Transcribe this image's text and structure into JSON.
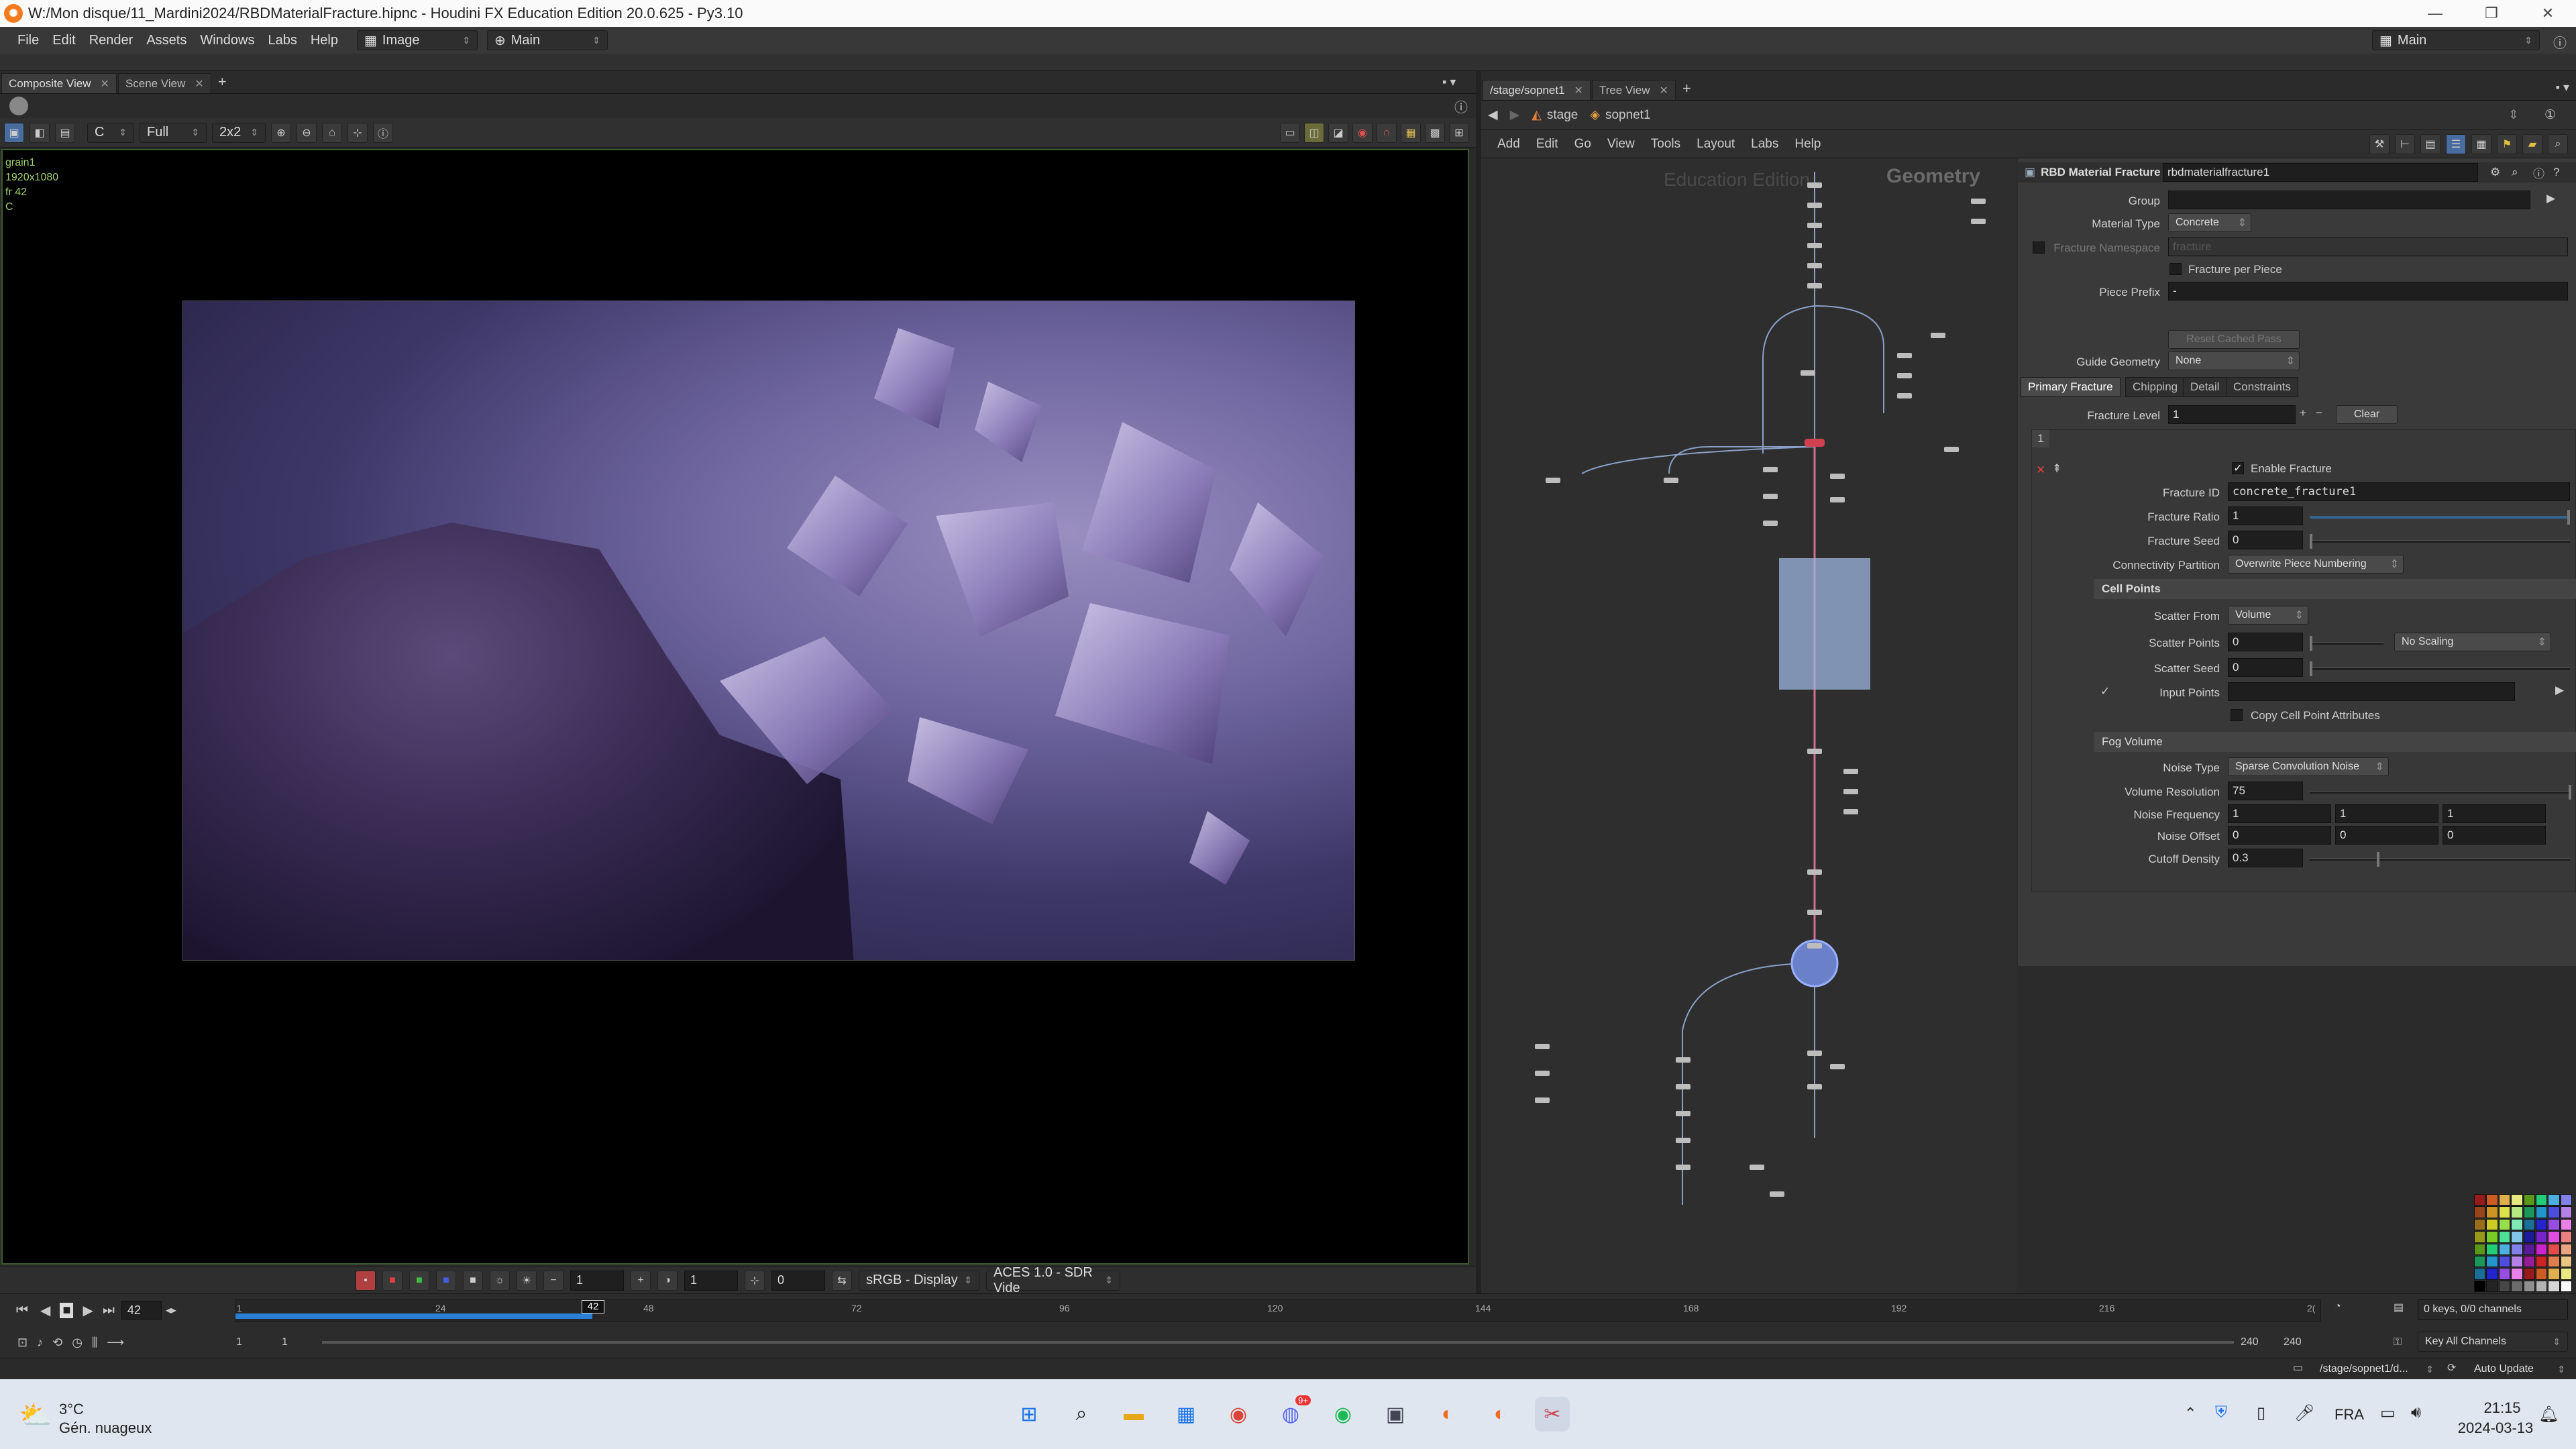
{
  "window": {
    "title": "W:/Mon disque/11_Mardini2024/RBDMaterialFracture.hipnc - Houdini FX Education Edition 20.0.625 - Py3.10"
  },
  "menubar": {
    "items": [
      "File",
      "Edit",
      "Render",
      "Assets",
      "Windows",
      "Labs",
      "Help"
    ],
    "desktop": "Image",
    "runtime": "Main",
    "desktop_right": "Main"
  },
  "left_tabs": [
    {
      "label": "Composite View"
    },
    {
      "label": "Scene View"
    }
  ],
  "viewer": {
    "channel": "C",
    "resolution": "Full",
    "tile": "2x2",
    "info": {
      "name": "grain1",
      "size": "1920x1080",
      "frame": "fr 42",
      "channel": "C"
    },
    "bottom": {
      "frame_a": "1",
      "frame_b": "1",
      "frame_c": "0",
      "display": "sRGB - Display",
      "view": "ACES 1.0 - SDR Vide"
    }
  },
  "right_tabs": [
    {
      "label": "/stage/sopnet1"
    },
    {
      "label": "Tree View"
    }
  ],
  "path": {
    "root": "stage",
    "child": "sopnet1"
  },
  "net_menu": [
    "Add",
    "Edit",
    "Go",
    "View",
    "Tools",
    "Layout",
    "Labs",
    "Help"
  ],
  "network": {
    "edition_label": "Education Edition",
    "context_label": "Geometry"
  },
  "params": {
    "node_type": "RBD Material Fracture",
    "node_name": "rbdmaterialfracture1",
    "group_label": "Group",
    "group_value": "",
    "material_type_label": "Material Type",
    "material_type": "Concrete",
    "fracture_namespace_label": "Fracture Namespace",
    "fracture_namespace": "fracture",
    "fracture_per_piece": "Fracture per Piece",
    "piece_prefix_label": "Piece Prefix",
    "piece_prefix": "-",
    "reset_cached_pass": "Reset Cached Pass",
    "guide_geometry_label": "Guide Geometry",
    "guide_geometry": "None",
    "tabs": [
      "Primary Fracture",
      "Chipping",
      "Detail",
      "Constraints"
    ],
    "fracture_level_label": "Fracture Level",
    "fracture_level": "1",
    "clear": "Clear",
    "multiparm_index": "1",
    "enable_fracture": "Enable Fracture",
    "fracture_id_label": "Fracture ID",
    "fracture_id": "concrete_fracture1",
    "fracture_ratio_label": "Fracture Ratio",
    "fracture_ratio": "1",
    "fracture_seed_label": "Fracture Seed",
    "fracture_seed": "0",
    "connectivity_label": "Connectivity Partition",
    "connectivity": "Overwrite Piece Numbering",
    "cell_points_section": "Cell Points",
    "scatter_from_label": "Scatter From",
    "scatter_from": "Volume",
    "scatter_points_label": "Scatter Points",
    "scatter_points": "0",
    "scaling": "No Scaling",
    "scatter_seed_label": "Scatter Seed",
    "scatter_seed": "0",
    "input_points_label": "Input Points",
    "input_points": "",
    "copy_cell_attrs": "Copy Cell Point Attributes",
    "fog_section": "Fog Volume",
    "noise_type_label": "Noise Type",
    "noise_type": "Sparse Convolution Noise",
    "volume_resolution_label": "Volume Resolution",
    "volume_resolution": "75",
    "noise_frequency_label": "Noise Frequency",
    "noise_frequency": [
      "1",
      "1",
      "1"
    ],
    "noise_offset_label": "Noise Offset",
    "noise_offset": [
      "0",
      "0",
      "0"
    ],
    "cutoff_density_label": "Cutoff Density",
    "cutoff_density": "0.3"
  },
  "timeline": {
    "current_frame": "42",
    "ticks": [
      "1",
      "24",
      "48",
      "72",
      "96",
      "120",
      "144",
      "168",
      "192",
      "216",
      "2("
    ],
    "range_start": "1",
    "range_start2": "1",
    "range_end": "240",
    "range_end2": "240",
    "keys_info": "0 keys, 0/0 channels",
    "key_all": "Key All Channels"
  },
  "status": {
    "path": "/stage/sopnet1/d...",
    "update": "Auto Update"
  },
  "taskbar": {
    "weather_temp": "3°C",
    "weather_desc": "Gén. nuageux",
    "lang": "FRA",
    "time": "21:15",
    "date": "2024-03-13",
    "discord_badge": "9+"
  },
  "colors": {
    "accent_blue": "#2a7fd4",
    "viewer_border": "#3c5a2c",
    "wire_pink": "#d0708a"
  }
}
